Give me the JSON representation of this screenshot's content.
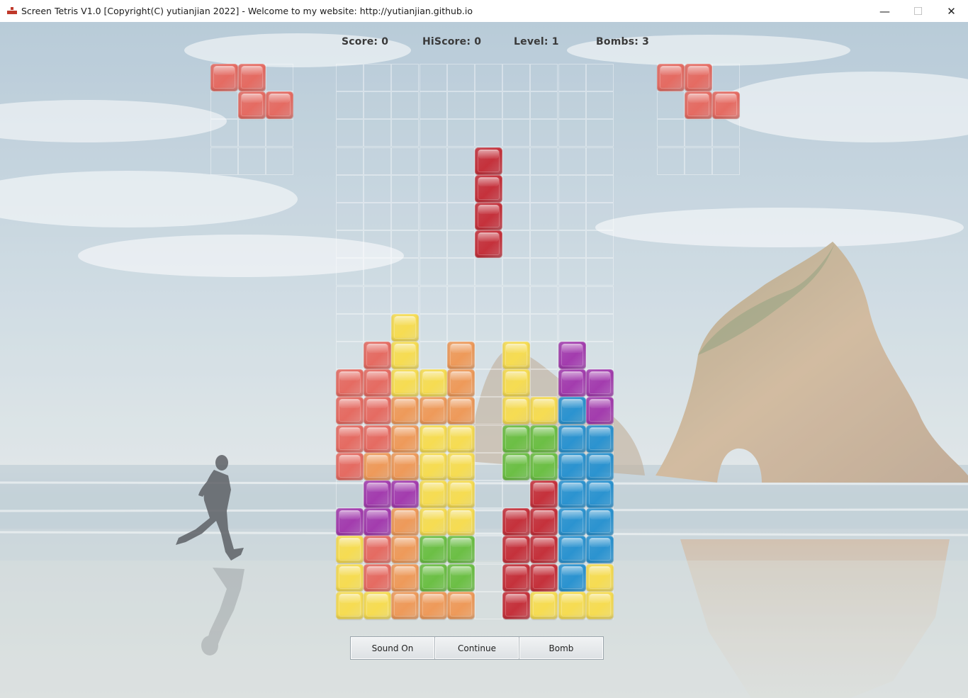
{
  "window": {
    "title": "Screen Tetris V1.0 [Copyright(C) yutianjian 2022] - Welcome to my website: http://yutianjian.github.io",
    "controls": {
      "minimize": "—",
      "maximize": "☐",
      "close": "✕"
    }
  },
  "stats": {
    "score": "Score: 0",
    "hiscore": "HiScore: 0",
    "level": "Level: 1",
    "bombs": "Bombs: 3"
  },
  "colors": {
    "R": "#e56b62",
    "D": "#c5313b",
    "O": "#ee9a5a",
    "Y": "#f6dc52",
    "G": "#6cbf45",
    "B": "#2b93d0",
    "P": "#a33cae"
  },
  "board": {
    "columns": 10,
    "rows": 20,
    "cells": [
      "..........",
      "..........",
      "..........",
      ".....D....",
      ".....D....",
      ".....D....",
      ".....D....",
      "..........",
      "..........",
      "..Y.......",
      ".RY.O.Y.P.",
      "RRYYO.Y.PP",
      "RROOO.YYBP",
      "RROYY.GGBB",
      "ROOYY.GGBB",
      ".PPYY..DBB",
      "PPOYY.DDBB",
      "YROGG.DDBB",
      "YROGG.DDBY",
      "YYOOO.DYYY"
    ]
  },
  "preview_left": {
    "columns": 3,
    "rows": 4,
    "cells": [
      "RR.",
      ".RR",
      "...",
      "..."
    ]
  },
  "preview_right": {
    "columns": 3,
    "rows": 4,
    "cells": [
      "RR.",
      ".RR",
      "...",
      "..."
    ]
  },
  "buttons": {
    "sound": "Sound On",
    "continue": "Continue",
    "bomb": "Bomb"
  }
}
